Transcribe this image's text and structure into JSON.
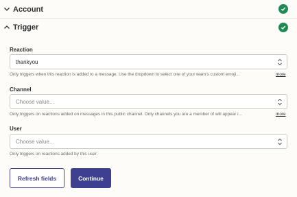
{
  "sections": {
    "account": {
      "title": "Account",
      "status": "complete"
    },
    "trigger": {
      "title": "Trigger",
      "status": "complete"
    }
  },
  "fields": [
    {
      "label": "Reaction",
      "value": "thankyou",
      "placeholder": "",
      "help": "Only triggers when this reaction is added to a message. Use the dropdown to select one of your team's custom emoji...",
      "more": "more"
    },
    {
      "label": "Channel",
      "value": "",
      "placeholder": "Choose value...",
      "help": "Only triggers on reactions added on messages in this public channel. Only channels you are a member of will appear i...",
      "more": "more"
    },
    {
      "label": "User",
      "value": "",
      "placeholder": "Choose value...",
      "help": "Only triggers on reactions added by this user.",
      "more": ""
    }
  ],
  "buttons": {
    "refresh": "Refresh fields",
    "continue": "Continue"
  },
  "colors": {
    "accent": "#3d3f8f",
    "success": "#1e8a56"
  },
  "icons": {
    "collapsed": "chevron-down-icon",
    "expanded": "chevron-up-icon",
    "status": "check-circle-icon",
    "select": "up-down-arrows-icon"
  }
}
